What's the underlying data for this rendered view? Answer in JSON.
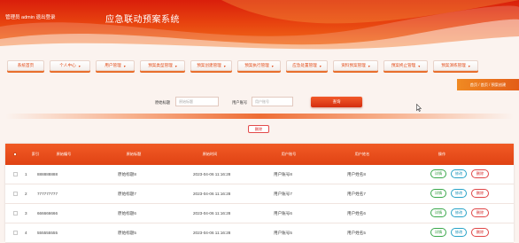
{
  "header": {
    "admin_line": "管理员 admin  退出登录",
    "system_title": "应急联动预案系统"
  },
  "nav": {
    "items": [
      {
        "label": "系统首页",
        "has_dropdown": false
      },
      {
        "label": "个人中心",
        "has_dropdown": true
      },
      {
        "label": "用户管理",
        "has_dropdown": true
      },
      {
        "label": "预案类型管理",
        "has_dropdown": true
      },
      {
        "label": "预案创建管理",
        "has_dropdown": true
      },
      {
        "label": "预案执行管理",
        "has_dropdown": true
      },
      {
        "label": "应急处置管理",
        "has_dropdown": true
      },
      {
        "label": "资料预案管理",
        "has_dropdown": true
      },
      {
        "label": "预案终止管理",
        "has_dropdown": true
      },
      {
        "label": "预案演练管理",
        "has_dropdown": true
      }
    ]
  },
  "breadcrumb": "首页 / 首页 / 预案创建",
  "search": {
    "field1_label": "原始标题",
    "field1_placeholder": "原始标题",
    "field2_label": "用户账号",
    "field2_placeholder": "用户账号",
    "submit_label": "查询"
  },
  "actions": {
    "delete_label": "删除"
  },
  "table": {
    "headers": {
      "index": "索引",
      "col1": "原始编号",
      "col2": "原始标题",
      "col3": "原始时间",
      "col4": "用户账号",
      "col5": "用户姓名",
      "col6": "操作"
    },
    "buttons": {
      "detail": "详情",
      "edit": "修改",
      "delete": "删除"
    },
    "rows": [
      {
        "index": "1",
        "code": "888888888",
        "title": "原始标题8",
        "time": "2023-04-06 11:16:28",
        "account": "用户账号8",
        "name": "用户姓名8"
      },
      {
        "index": "2",
        "code": "777777777",
        "title": "原始标题7",
        "time": "2023-04-06 11:16:28",
        "account": "用户账号7",
        "name": "用户姓名7"
      },
      {
        "index": "3",
        "code": "666666666",
        "title": "原始标题6",
        "time": "2023-04-06 11:16:28",
        "account": "用户账号6",
        "name": "用户姓名6"
      },
      {
        "index": "4",
        "code": "555555555",
        "title": "原始标题5",
        "time": "2023-04-06 11:16:28",
        "account": "用户账号5",
        "name": "用户姓名5"
      }
    ]
  }
}
